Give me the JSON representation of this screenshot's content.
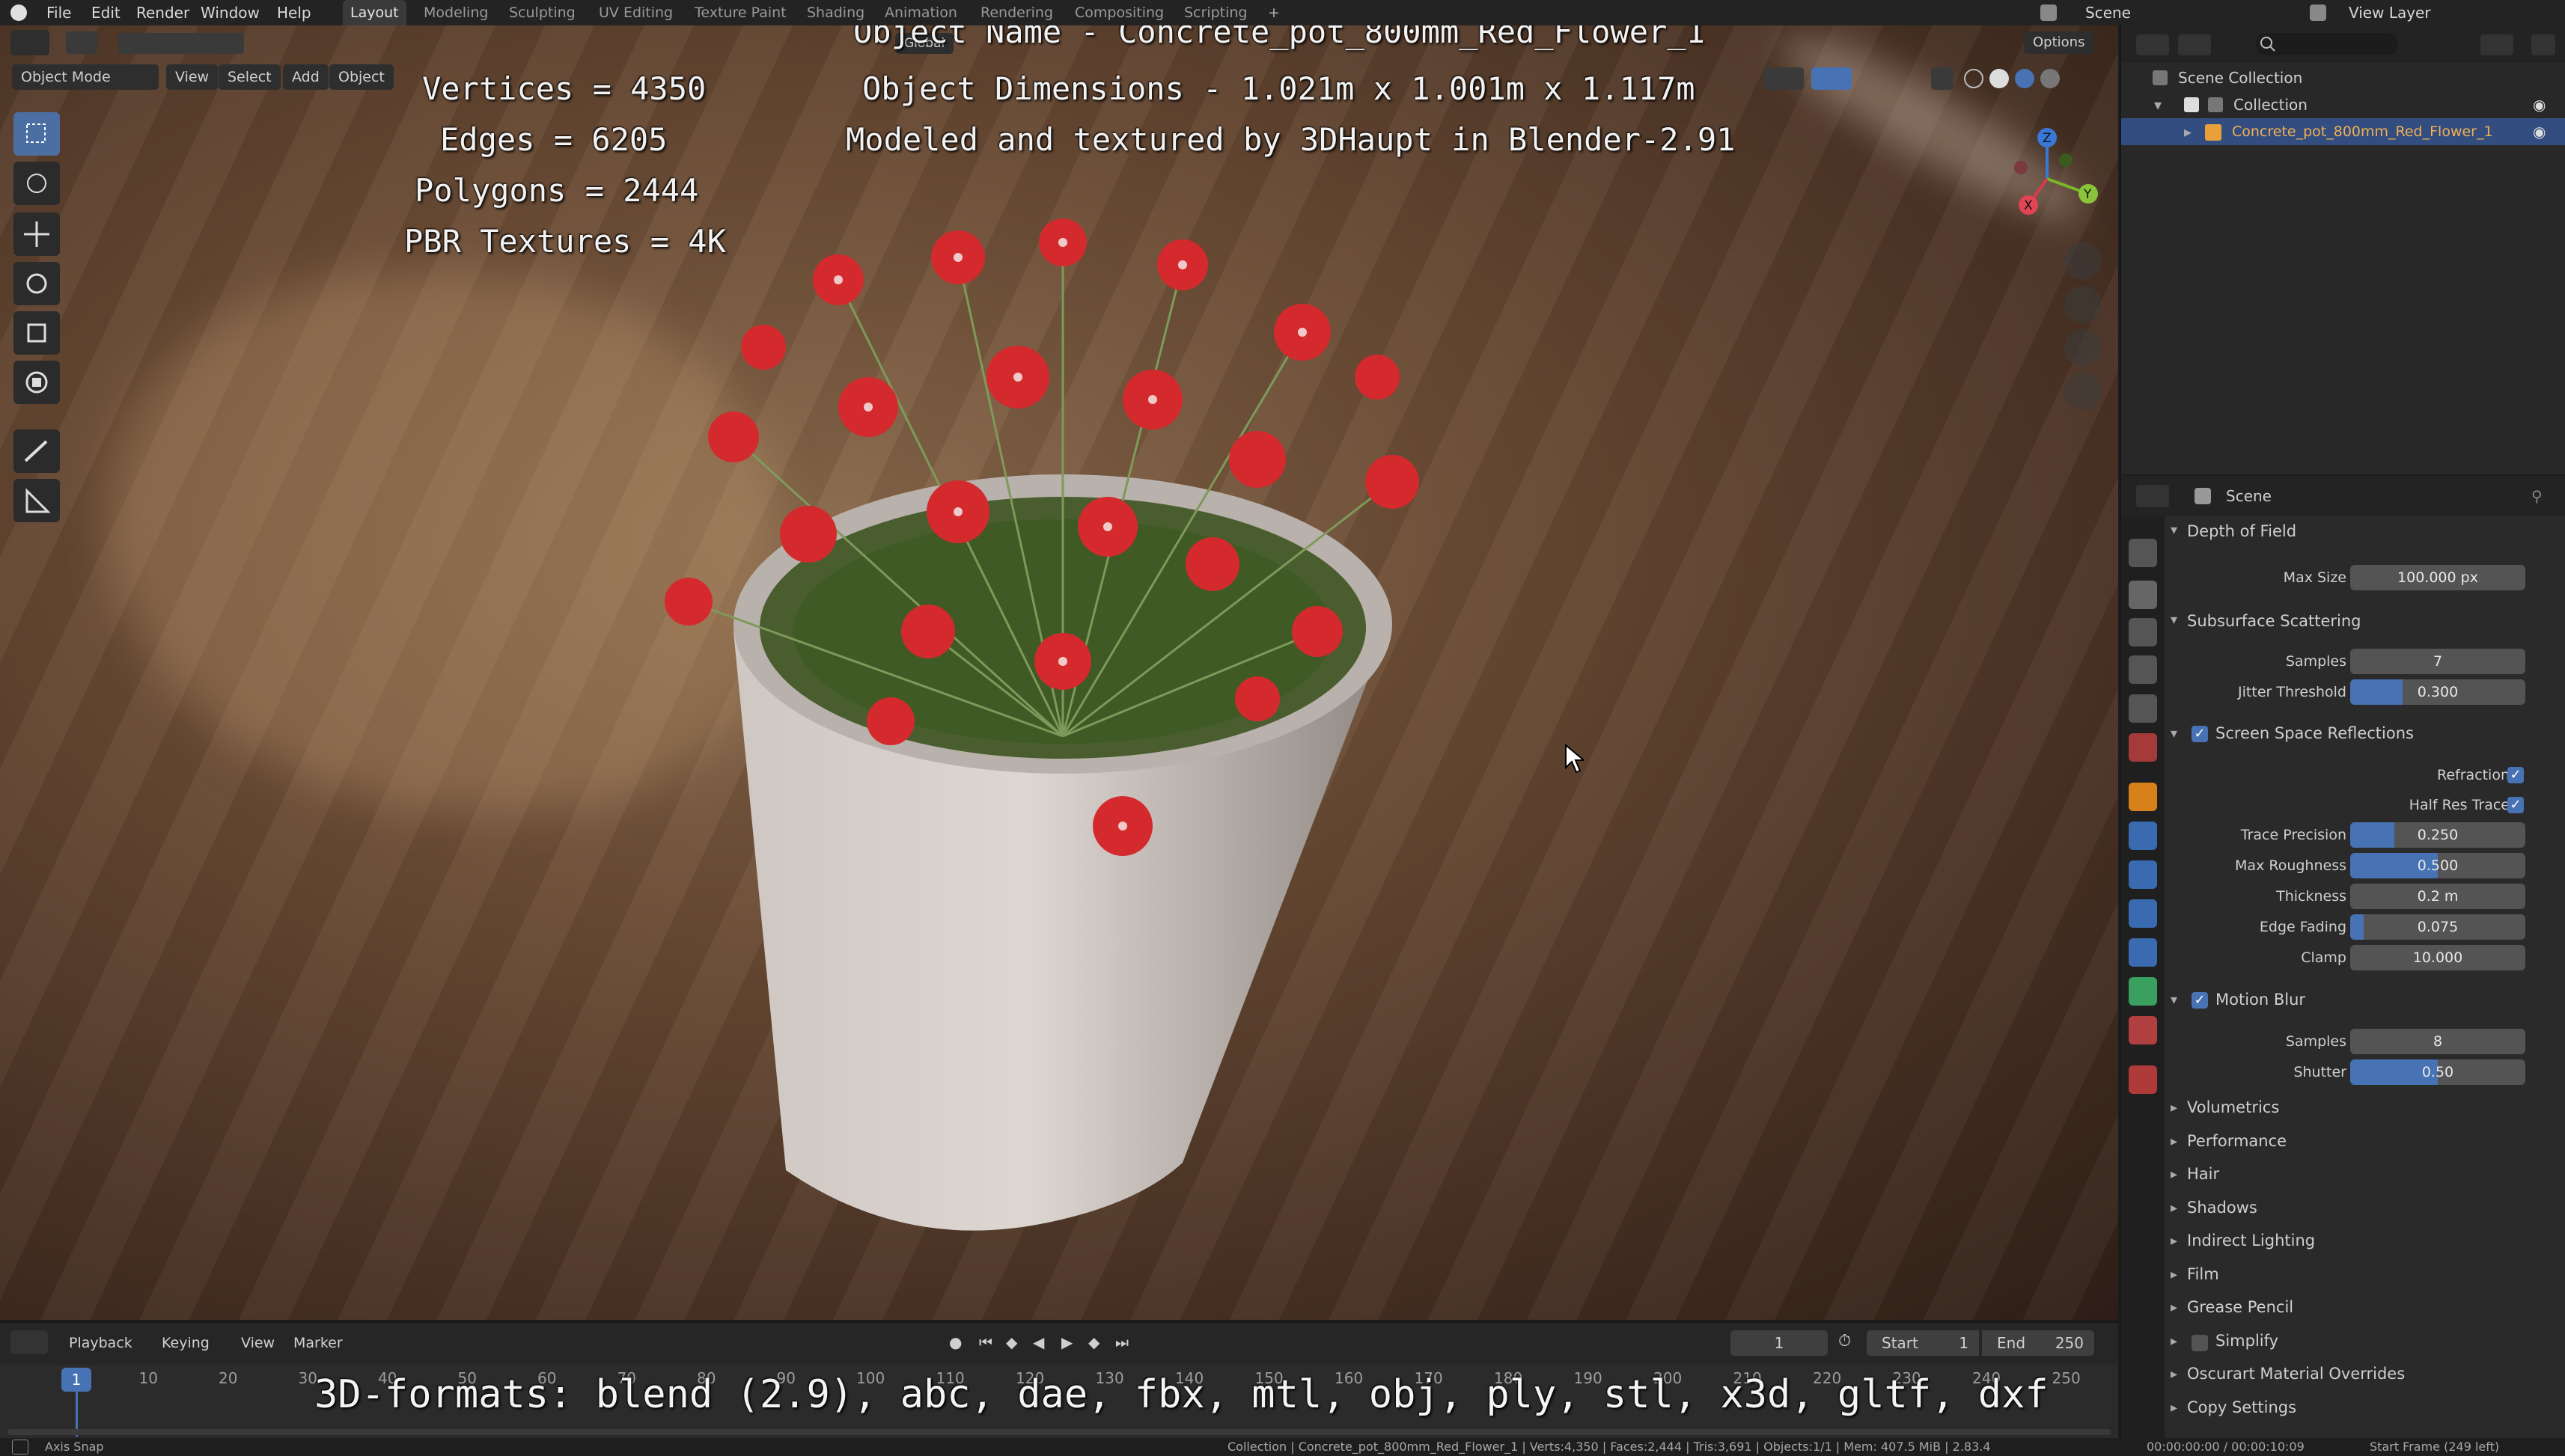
{
  "topbar": {
    "menus": [
      "File",
      "Edit",
      "Render",
      "Window",
      "Help"
    ],
    "workspaces": [
      "Layout",
      "Modeling",
      "Sculpting",
      "UV Editing",
      "Texture Paint",
      "Shading",
      "Animation",
      "Rendering",
      "Compositing",
      "Scripting"
    ],
    "active_workspace": "Layout",
    "scene": "Scene",
    "view_layer": "View Layer"
  },
  "viewport": {
    "mode": "Object Mode",
    "menus": [
      "View",
      "Select",
      "Add",
      "Object"
    ],
    "transform_orientation": "Global",
    "options_label": "Options",
    "stats": [
      "Vertices = 4350",
      "Edges = 6205",
      "Polygons = 2444",
      "PBR Textures = 4K"
    ],
    "info_lines": [
      "Object Name - Concrete_pot_800mm_Red_Flower_1",
      "Object Dimensions -  1.021m x 1.001m x 1.117m",
      "Modeled and textured by 3DHaupt in Blender-2.91"
    ],
    "formats": "3D-formats: blend (2.9), abc, dae, fbx, mtl, obj, ply, stl, x3d, gltf, dxf",
    "gizmo_axes": [
      "Z",
      "Y",
      "X"
    ]
  },
  "outliner": {
    "rows": [
      "Scene Collection",
      "Collection",
      "Concrete_pot_800mm_Red_Flower_1"
    ]
  },
  "properties": {
    "context": "Scene",
    "panels": {
      "dof": {
        "title": "Depth of Field",
        "max_size_label": "Max Size",
        "max_size": "100.000 px"
      },
      "sss": {
        "title": "Subsurface Scattering",
        "samples_label": "Samples",
        "samples": "7",
        "jitter_label": "Jitter Threshold",
        "jitter": "0.300",
        "jitter_fill": 0.3
      },
      "ssr": {
        "title": "Screen Space Reflections",
        "enabled": true,
        "refraction_label": "Refraction",
        "half_res_label": "Half Res Trace",
        "trace_precision_label": "Trace Precision",
        "trace_precision": "0.250",
        "trace_precision_fill": 0.25,
        "max_roughness_label": "Max Roughness",
        "max_roughness": "0.500",
        "max_roughness_fill": 0.5,
        "thickness_label": "Thickness",
        "thickness": "0.2 m",
        "edge_fading_label": "Edge Fading",
        "edge_fading": "0.075",
        "edge_fading_fill": 0.075,
        "clamp_label": "Clamp",
        "clamp": "10.000"
      },
      "motion_blur": {
        "title": "Motion Blur",
        "enabled": true,
        "samples_label": "Samples",
        "samples": "8",
        "shutter_label": "Shutter",
        "shutter": "0.50",
        "shutter_fill": 0.5
      }
    },
    "collapsed_panels": [
      "Volumetrics",
      "Performance",
      "Hair",
      "Shadows",
      "Indirect Lighting",
      "Film",
      "Grease Pencil",
      "Simplify",
      "Oscurart Material Overrides",
      "Copy Settings"
    ]
  },
  "timeline": {
    "menus": [
      "Playback",
      "Keying",
      "View",
      "Marker"
    ],
    "current_frame": "1",
    "start_label": "Start",
    "start": "1",
    "end_label": "End",
    "end": "250",
    "frame_ticks": [
      "1",
      "10",
      "20",
      "30",
      "40",
      "50",
      "60",
      "70",
      "80",
      "90",
      "100",
      "110",
      "120",
      "130",
      "140",
      "150",
      "160",
      "170",
      "180",
      "190",
      "200",
      "210",
      "220",
      "230",
      "240",
      "250"
    ]
  },
  "statusbar": {
    "left": "Axis Snap",
    "stats": "Collection | Concrete_pot_800mm_Red_Flower_1 | Verts:4,350 | Faces:2,444 | Tris:3,691 | Objects:1/1 | Mem: 407.5 MiB | 2.83.4",
    "time": "00:00:00:00 / 00:00:10:09",
    "start_frame": "Start Frame (249 left)"
  },
  "colors": {
    "accent": "#4772b3",
    "selected_object": "#e8a13a",
    "flower": "#d8262a"
  }
}
